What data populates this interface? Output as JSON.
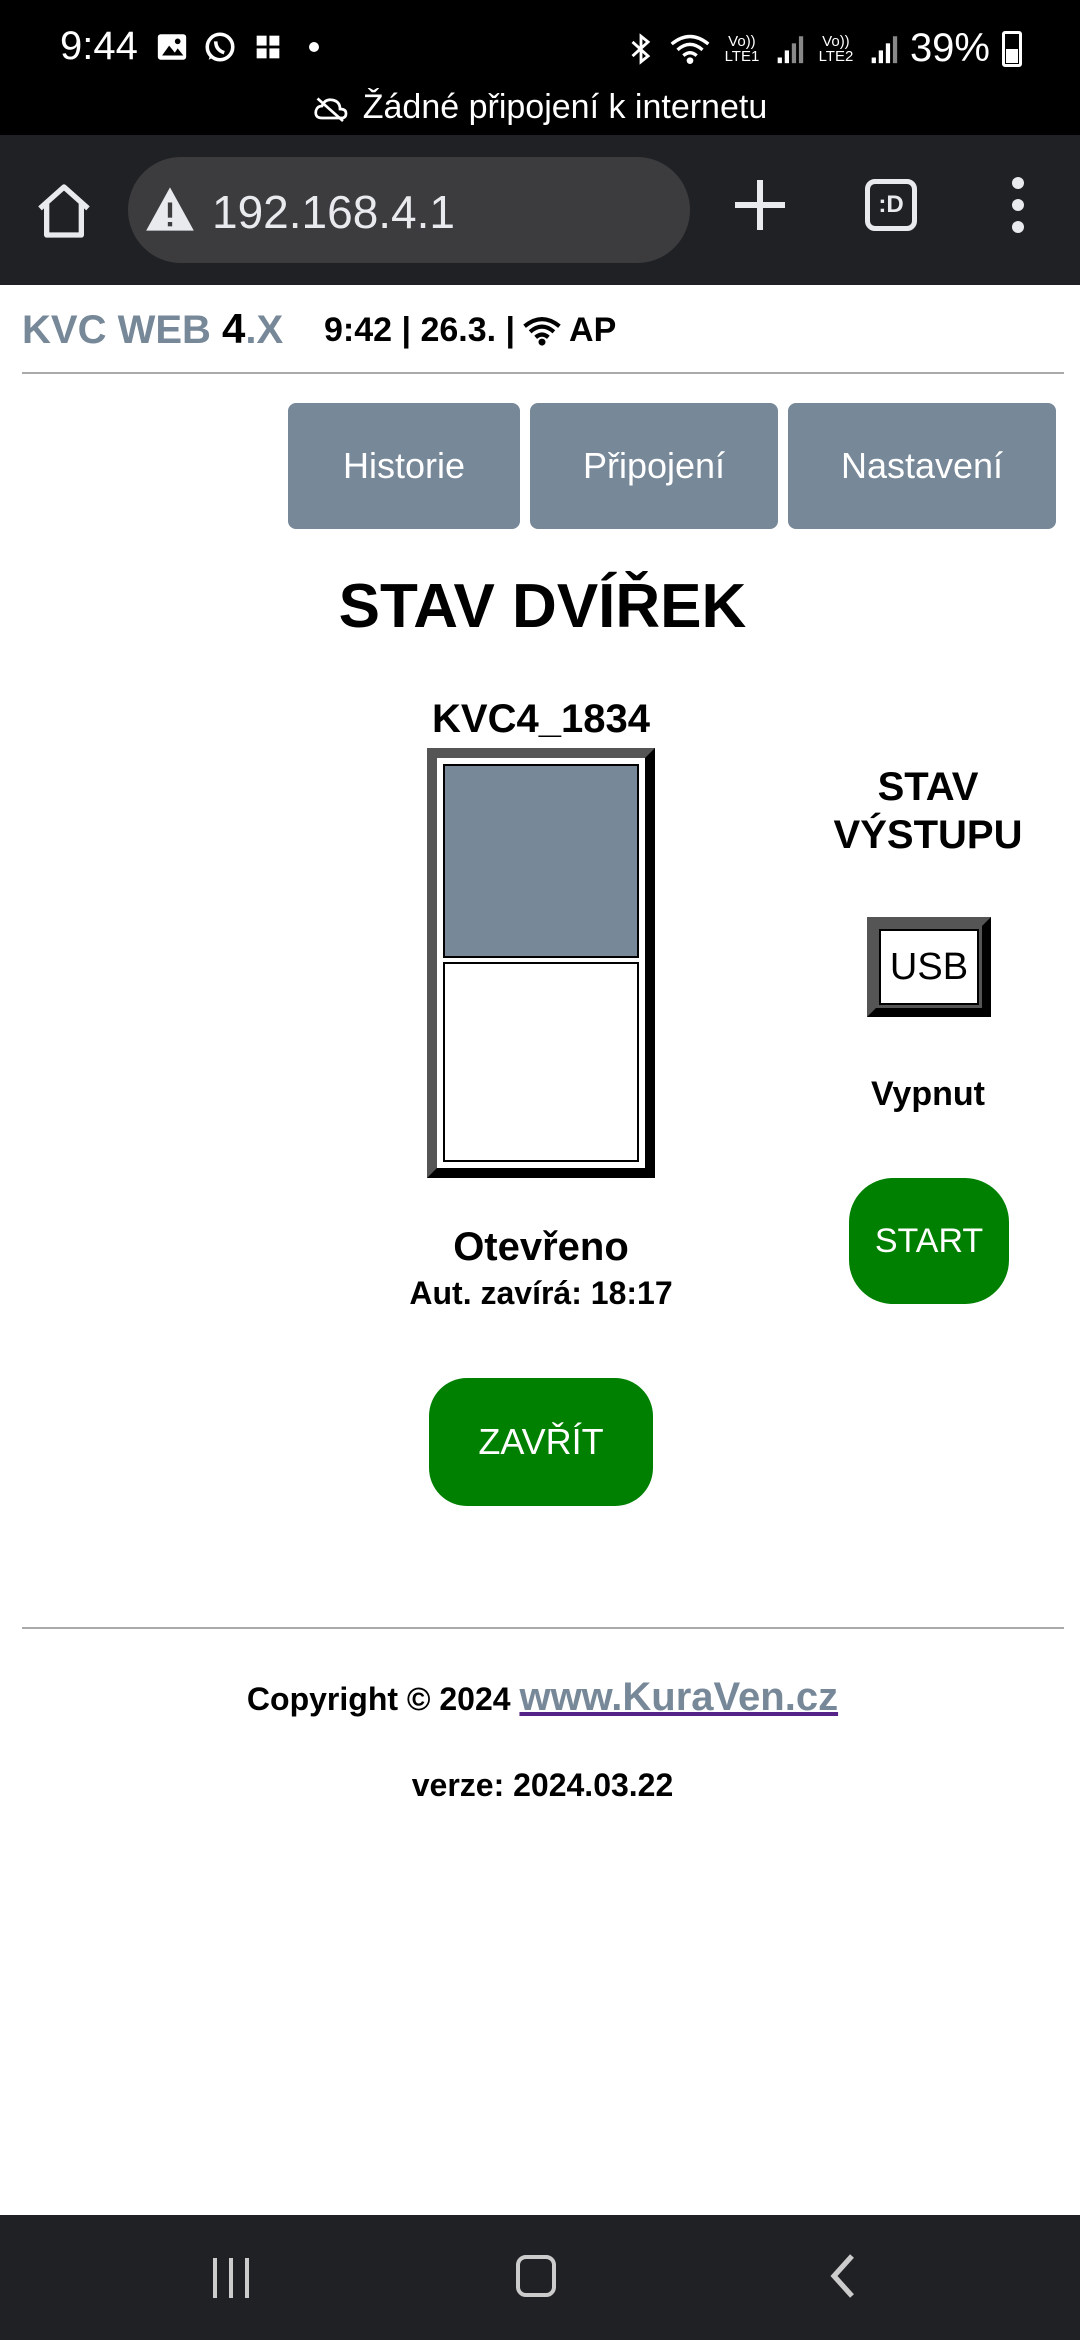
{
  "status_bar": {
    "time": "9:44",
    "battery": "39%",
    "sim1_label": "Vo)) LTE1",
    "sim2_label": "Vo)) LTE2",
    "offline_text": "Žádné připojení k internetu"
  },
  "browser": {
    "url": "192.168.4.1",
    "tabs_label": ":D"
  },
  "header": {
    "brand": "KVC WEB ",
    "brand_version": "4",
    "brand_suffix": ".X",
    "status_time": "9:42 | 26.3. |",
    "status_mode": "AP"
  },
  "nav": {
    "history": "Historie",
    "connection": "Připojení",
    "settings": "Nastavení"
  },
  "main": {
    "title": "STAV DVÍŘEK",
    "device_name": "KVC4_1834",
    "door_state": "Otevřeno",
    "auto_close": "Aut. zavírá: 18:17",
    "close_button": "ZAVŘÍT",
    "door_open_fraction": 0.5
  },
  "output": {
    "title_line1": "STAV",
    "title_line2": "VÝSTUPU",
    "box_label": "USB",
    "state": "Vypnut",
    "start_button": "START"
  },
  "footer": {
    "copyright": "Copyright © 2024 ",
    "link": "www.KuraVen.cz",
    "version": "verze: 2024.03.22"
  },
  "colors": {
    "slate": "#778899",
    "green": "#008000"
  }
}
